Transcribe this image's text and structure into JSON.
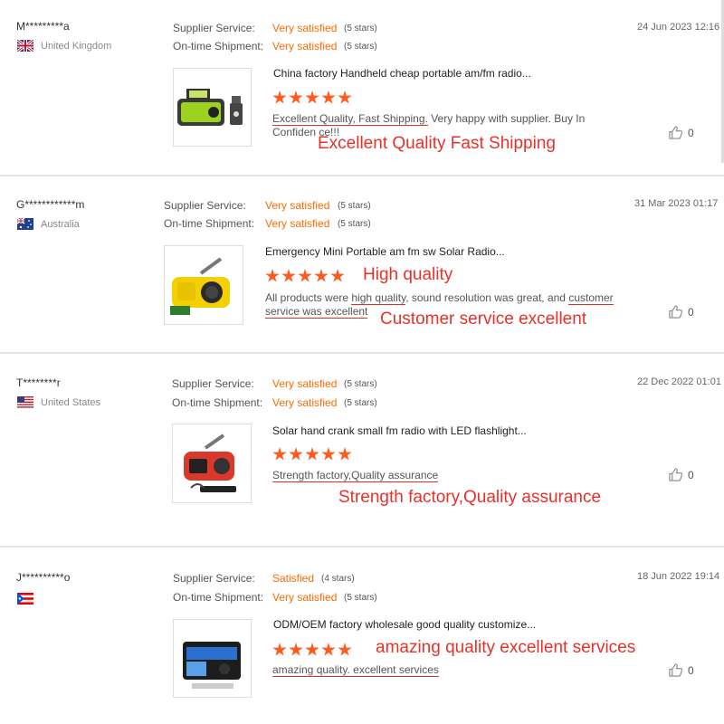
{
  "labels": {
    "supplier_service": "Supplier Service:",
    "ontime_shipment": "On-time Shipment:"
  },
  "reviews": [
    {
      "user": "M*********a",
      "country": "United Kingdom",
      "supplier_value": "Very satisfied",
      "supplier_stars": "(5 stars)",
      "shipment_value": "Very satisfied",
      "shipment_stars": "(5 stars)",
      "date": "24 Jun 2023 12:16",
      "product": "China factory Handheld cheap portable am/fm radio...",
      "rating": 5,
      "comment_a": "Excellent Quality, Fast Shipping.",
      "comment_b": " Very happy with supplier. Buy In Confiden ce!!!",
      "annotation_1": "Excellent Quality  Fast Shipping",
      "likes": "0"
    },
    {
      "user": "G************m",
      "country": "Australia",
      "supplier_value": "Very satisfied",
      "supplier_stars": "(5 stars)",
      "shipment_value": "Very satisfied",
      "shipment_stars": "(5 stars)",
      "date": "31 Mar 2023 01:17",
      "product": "Emergency Mini Portable am fm sw Solar Radio...",
      "rating": 5,
      "comment_1": "All products were ",
      "comment_2": "high quality",
      "comment_3": ", sound resolution was great, and ",
      "comment_4": "customer",
      "comment_5": "service was excellent",
      "annotation_1": "High quality",
      "annotation_2": "Customer service excellent",
      "likes": "0"
    },
    {
      "user": "T********r",
      "country": "United States",
      "supplier_value": "Very satisfied",
      "supplier_stars": "(5 stars)",
      "shipment_value": "Very satisfied",
      "shipment_stars": "(5 stars)",
      "date": "22 Dec 2022 01:01",
      "product": "Solar hand crank small fm radio with LED flashlight...",
      "rating": 5,
      "comment": "Strength factory,Quality assurance",
      "annotation_1": "Strength factory,Quality assurance",
      "likes": "0"
    },
    {
      "user": "J**********o",
      "country": "",
      "supplier_value": "Satisfied",
      "supplier_stars": "(4 stars)",
      "shipment_value": "Very satisfied",
      "shipment_stars": "(5 stars)",
      "date": "18 Jun 2022 19:14",
      "product": "ODM/OEM factory wholesale good quality customize...",
      "rating": 5,
      "comment": "amazing quality. excellent services",
      "annotation_1": "amazing quality excellent services",
      "likes": "0"
    }
  ],
  "colors": {
    "accent": "#ff6a00",
    "star": "#ff5a1f",
    "annotation": "#e8312a"
  }
}
